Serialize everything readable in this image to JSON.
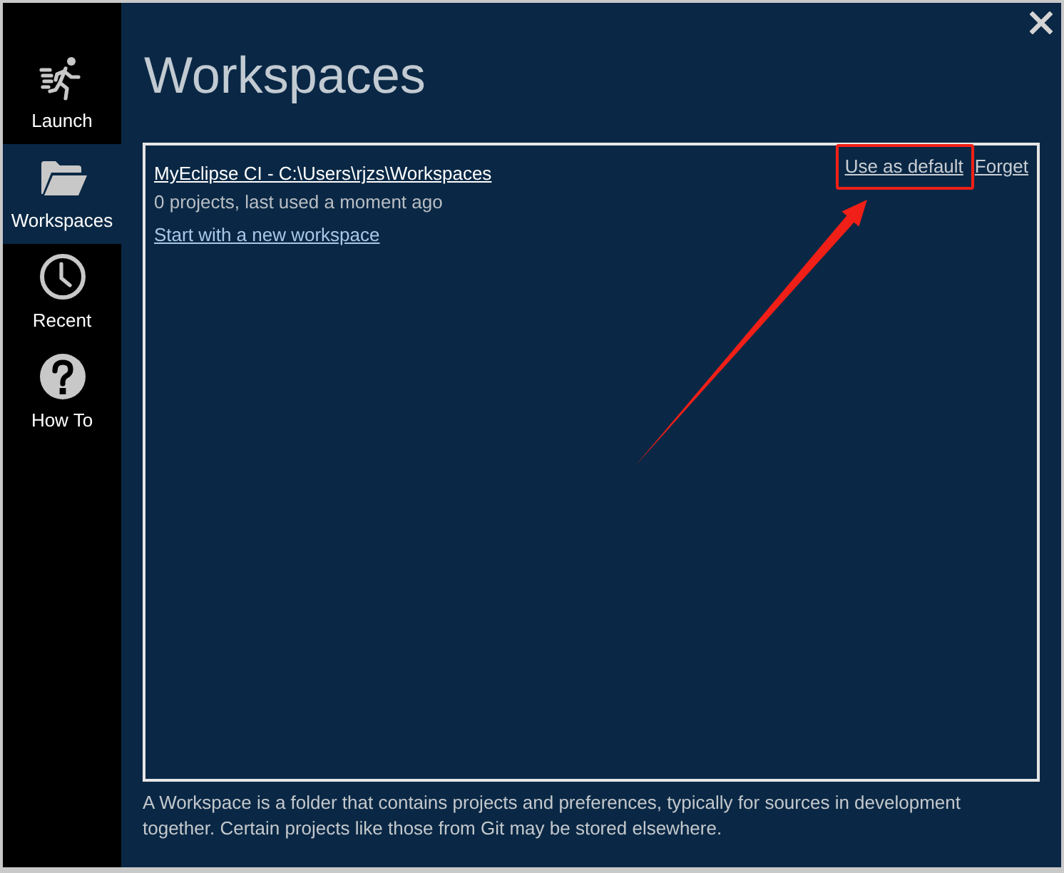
{
  "sidebar": {
    "items": [
      {
        "label": "Launch",
        "kind": "launch",
        "selected": false
      },
      {
        "label": "Workspaces",
        "kind": "folder",
        "selected": true
      },
      {
        "label": "Recent",
        "kind": "clock",
        "selected": false
      },
      {
        "label": "How To",
        "kind": "help",
        "selected": false
      }
    ]
  },
  "title": "Workspaces",
  "workspaces": [
    {
      "name": "MyEclipse CI - C:\\Users\\rjzs\\Workspaces",
      "details": "0 projects, last used a moment ago",
      "actions": [
        {
          "label": "Use as default",
          "highlighted": true
        },
        {
          "label": "Forget",
          "highlighted": false
        }
      ]
    }
  ],
  "new_workspace_link": "Start with a new workspace",
  "footer": "A Workspace is a folder that contains projects and preferences, typically for sources in development together. Certain projects like those from Git may be stored elsewhere."
}
